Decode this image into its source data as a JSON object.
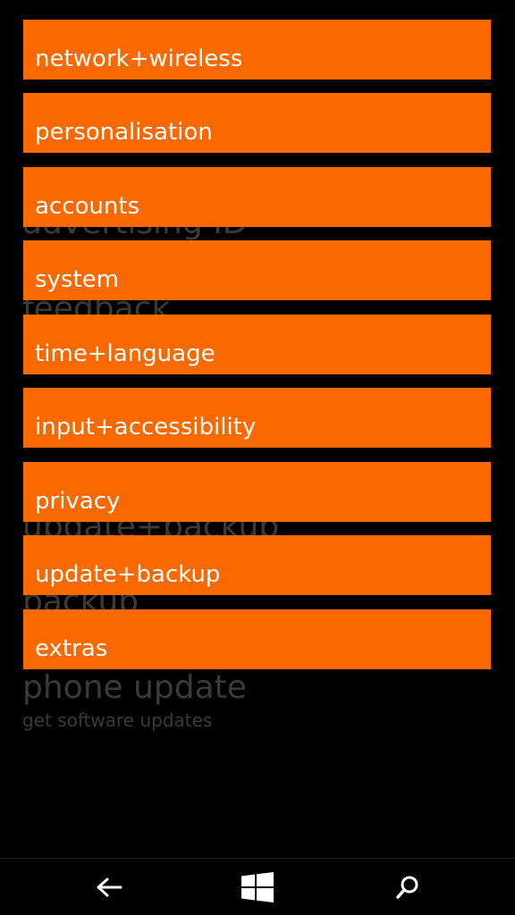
{
  "background_list": {
    "items": [
      {
        "title": "advertising ID"
      },
      {
        "title": "feedback"
      },
      {
        "title": "update+backup"
      },
      {
        "title": "backup"
      },
      {
        "title": "phone update",
        "subtitle": "get software updates"
      }
    ]
  },
  "categories": [
    {
      "label": "network+wireless"
    },
    {
      "label": "personalisation"
    },
    {
      "label": "accounts"
    },
    {
      "label": "system"
    },
    {
      "label": "time+language"
    },
    {
      "label": "input+accessibility"
    },
    {
      "label": "privacy"
    },
    {
      "label": "update+backup"
    },
    {
      "label": "extras"
    }
  ],
  "navbar": {
    "back_icon": "back-arrow-icon",
    "start_icon": "windows-start-icon",
    "search_icon": "search-icon"
  },
  "colors": {
    "accent": "#fa6800",
    "background": "#000000",
    "tile_text": "#ffffff",
    "dim_text": "#3a3a3a"
  }
}
